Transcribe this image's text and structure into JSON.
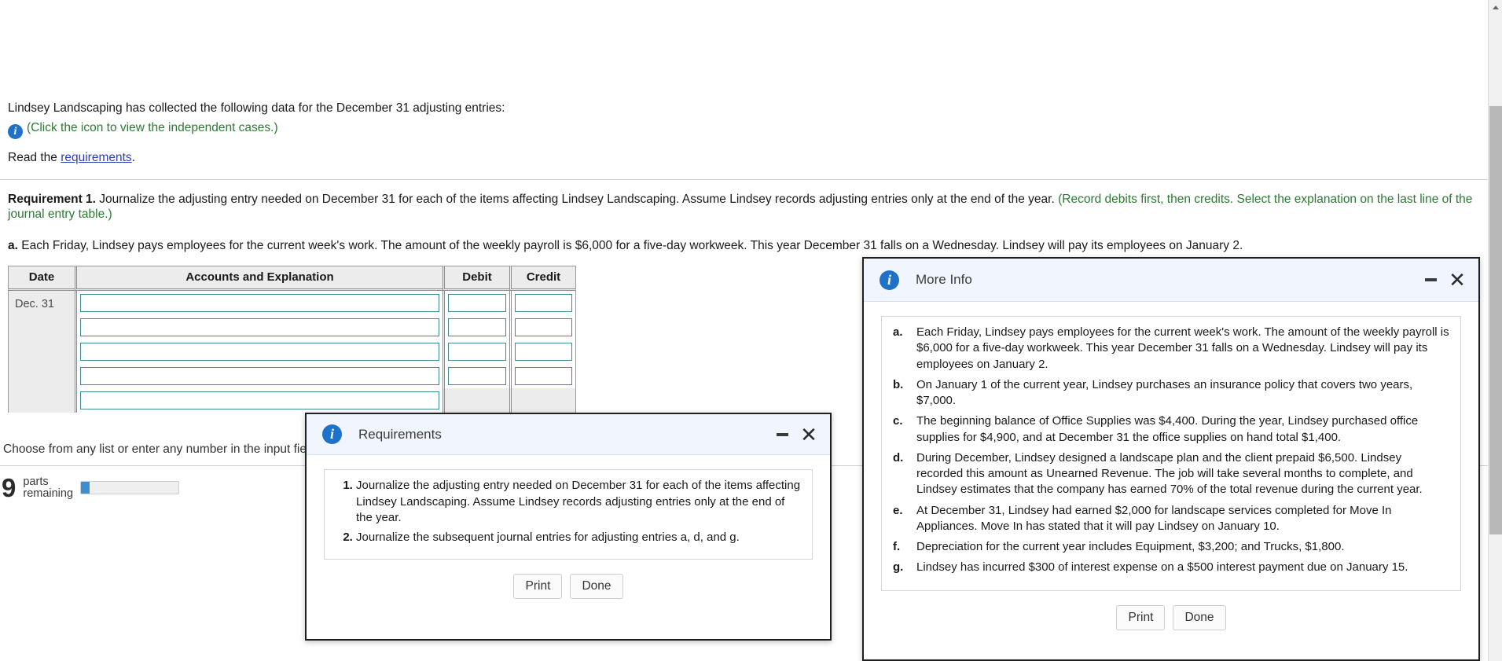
{
  "worksheet": {
    "intro": "Lindsey Landscaping has collected the following data for the December 31 adjusting entries:",
    "icon_link_text": "(Click the icon to view the independent cases.)",
    "read_prefix": "Read the ",
    "read_link": "requirements",
    "read_suffix": ".",
    "requirement_label": "Requirement 1.",
    "requirement_text": " Journalize the adjusting entry needed on December 31 for each of the items affecting Lindsey Landscaping. Assume Lindsey records adjusting entries only at the end of the year.",
    "requirement_hint": "(Record debits first, then credits. Select the explanation on the last line of the journal entry table.)",
    "item_a_marker": "a.",
    "item_a_text": " Each Friday, Lindsey pays employees for the current week's work. The amount of the weekly payroll is $6,000 for a five-day workweek. This year December 31 falls on a Wednesday. Lindsey will pay its employees on January 2.",
    "footer_note": "Choose from any list or enter any number in the input fields and then continue to the next question.",
    "parts_number": "9",
    "parts_label_line1": "parts",
    "parts_label_line2": "remaining",
    "progress_percent": "8.5"
  },
  "journal": {
    "columns": [
      "Date",
      "Accounts and Explanation",
      "Debit",
      "Credit"
    ],
    "rows": [
      {
        "date": "Dec. 31",
        "account": "",
        "debit": "",
        "credit": ""
      },
      {
        "date": "",
        "account": "",
        "debit": "",
        "credit": ""
      },
      {
        "date": "",
        "account": "",
        "debit": "",
        "credit": ""
      },
      {
        "date": "",
        "account": "",
        "debit": "",
        "credit": ""
      },
      {
        "date": "",
        "account": "",
        "debit": "",
        "credit": ""
      }
    ]
  },
  "requirements_dialog": {
    "title": "Requirements",
    "icon": "info-icon",
    "minimize_icon": "minimize-icon",
    "close_icon": "close-icon",
    "items": [
      "Journalize the adjusting entry needed on December 31 for each of the items affecting Lindsey Landscaping. Assume Lindsey records adjusting entries only at the end of the year.",
      "Journalize the subsequent journal entries for adjusting entries a, d, and g."
    ],
    "print_label": "Print",
    "done_label": "Done"
  },
  "moreinfo_dialog": {
    "title": "More Info",
    "icon": "info-icon",
    "minimize_icon": "minimize-icon",
    "close_icon": "close-icon",
    "items": [
      {
        "marker": "a.",
        "text": "Each Friday, Lindsey pays employees for the current week's work. The amount of the weekly payroll is $6,000 for a five-day workweek. This year December 31 falls on a Wednesday. Lindsey will pay its employees on January 2."
      },
      {
        "marker": "b.",
        "text": "On January 1 of the current year, Lindsey purchases an insurance policy that covers two years, $7,000."
      },
      {
        "marker": "c.",
        "text": "The beginning balance of Office Supplies was $4,400. During the year, Lindsey purchased office supplies for $4,900, and at December 31 the office supplies on hand total $1,400."
      },
      {
        "marker": "d.",
        "text": "During December, Lindsey designed a landscape plan and the client prepaid $6,500. Lindsey recorded this amount as Unearned Revenue. The job will take several months to complete, and Lindsey estimates that the company has earned 70% of the total revenue during the current year."
      },
      {
        "marker": "e.",
        "text": "At December 31, Lindsey had earned $2,000 for landscape services completed for Move In Appliances. Move In has stated that it will pay Lindsey on January 10."
      },
      {
        "marker": "f.",
        "text": "Depreciation for the current year includes Equipment, $3,200; and Trucks, $1,800."
      },
      {
        "marker": "g.",
        "text": "Lindsey has incurred $300 of interest expense on a $500 interest payment due on January 15."
      }
    ],
    "print_label": "Print",
    "done_label": "Done"
  },
  "scrollbar": {
    "up_icon": "scroll-up-arrow-icon",
    "thumb": "scroll-thumb"
  },
  "colors": {
    "accent": "#1e73c8",
    "hint_green": "#2d7a33",
    "link_blue": "#2b3fb5",
    "input_border": "#3f8b94",
    "progress": "#3d8ed0"
  }
}
